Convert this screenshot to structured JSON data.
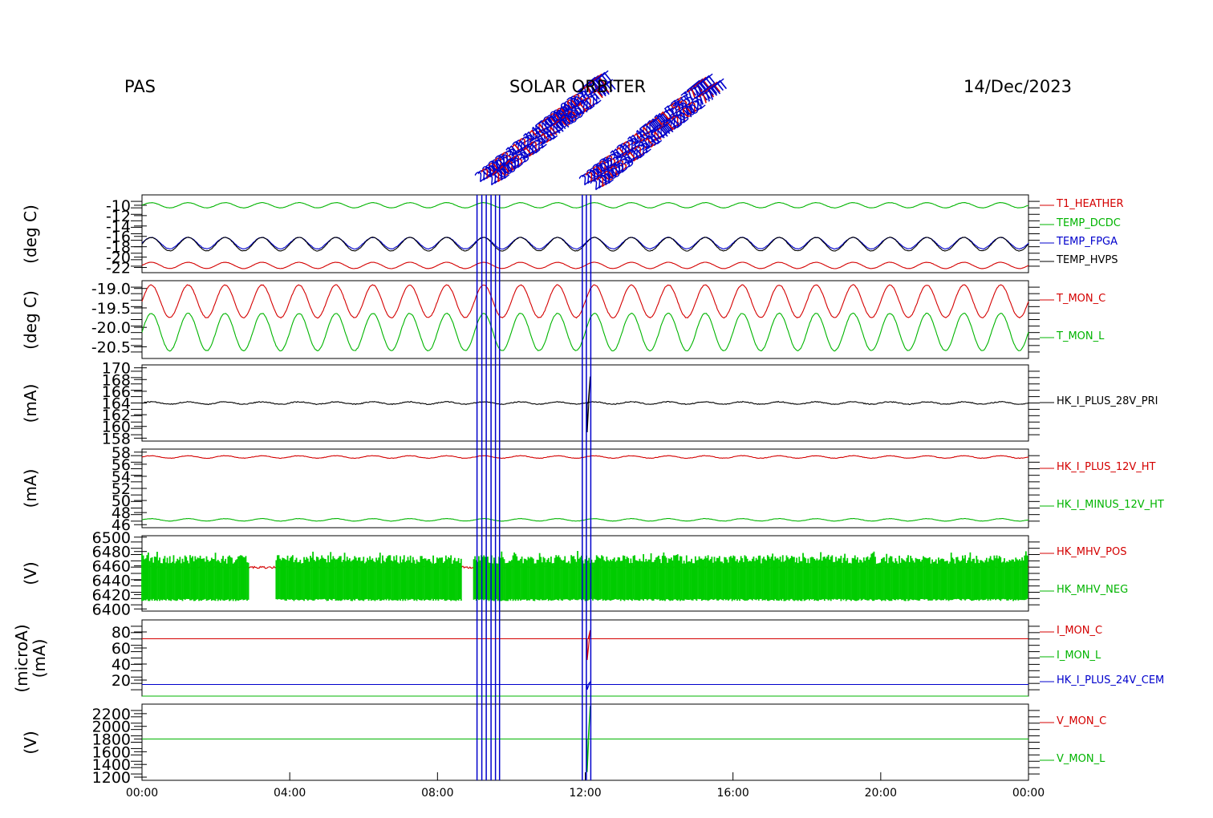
{
  "header": {
    "left": "PAS",
    "center": "SOLAR ORBITER",
    "right": "14/Dec/2023"
  },
  "colors": {
    "red": "#d40000",
    "green": "#00b400",
    "blue": "#0000cc",
    "black": "#000000",
    "fill_green": "#00cc00"
  },
  "events": {
    "times_hours": [
      9.07,
      9.2,
      9.32,
      9.45,
      9.57,
      9.68,
      11.92,
      12.03,
      12.15
    ],
    "labels": [
      "7TT",
      "TT",
      "7TT",
      "7TT"
    ],
    "label_lines": [
      "2023-12-14T09:03 7TT",
      "2023-12-14T09:12 TT",
      "2023-12-14T11:55 7TT",
      "2023-12-14T12:02 7TT"
    ]
  },
  "chart_data": [
    {
      "type": "line",
      "id": "temps",
      "ylabel": "(deg C)",
      "ylim": [
        -23,
        -8
      ],
      "yticks": [
        -10,
        -12,
        -14,
        -16,
        -18,
        -20,
        -22
      ],
      "ytick_labels": [
        "-10",
        "-12",
        "-14",
        "-16",
        "-18",
        "-20",
        "-22"
      ],
      "x_range_hours": [
        0,
        24
      ],
      "series": [
        {
          "name": "T1_HEATHER",
          "color": "red",
          "mean": -21.6,
          "amp": 0.6,
          "period_h": 1.0,
          "noise": 0.05
        },
        {
          "name": "TEMP_DCDC",
          "color": "green",
          "mean": -10.0,
          "amp": 0.5,
          "period_h": 1.0,
          "noise": 0.05
        },
        {
          "name": "TEMP_FPGA",
          "color": "blue",
          "mean": -17.3,
          "amp": 1.1,
          "period_h": 1.0,
          "noise": 0.1
        },
        {
          "name": "TEMP_HVPS",
          "color": "black",
          "mean": -17.5,
          "amp": 1.3,
          "period_h": 1.0,
          "noise": 0.1
        }
      ]
    },
    {
      "type": "line",
      "id": "tmon",
      "ylabel": "(deg C)",
      "ylim": [
        -20.8,
        -18.8
      ],
      "yticks": [
        -19.0,
        -19.5,
        -20.0,
        -20.5
      ],
      "ytick_labels": [
        "-19.0",
        "-19.5",
        "-20.0",
        "-20.5"
      ],
      "x_range_hours": [
        0,
        24
      ],
      "series": [
        {
          "name": "T_MON_C",
          "color": "red",
          "mean": -19.33,
          "amp": 0.42,
          "period_h": 1.0,
          "noise": 0.02
        },
        {
          "name": "T_MON_L",
          "color": "green",
          "mean": -20.12,
          "amp": 0.48,
          "period_h": 1.0,
          "noise": 0.02
        }
      ]
    },
    {
      "type": "line",
      "id": "i28",
      "ylabel": "(mA)",
      "ylim": [
        157.5,
        170.5
      ],
      "yticks": [
        158,
        160,
        162,
        164,
        166,
        168,
        170
      ],
      "ytick_labels": [
        "158",
        "160",
        "162",
        "164",
        "166",
        "168",
        "170"
      ],
      "x_range_hours": [
        0,
        24
      ],
      "series": [
        {
          "name": "HK_I_PLUS_28V_PRI",
          "color": "black",
          "mean": 164.0,
          "amp": 0.2,
          "period_h": 1.0,
          "noise": 0.15,
          "spike": {
            "at_h": 12.05,
            "low": 159.0,
            "high": 168.5
          }
        }
      ]
    },
    {
      "type": "line",
      "id": "i12",
      "ylabel": "(mA)",
      "ylim": [
        45.5,
        58.5
      ],
      "yticks": [
        46,
        48,
        50,
        52,
        54,
        56,
        58
      ],
      "ytick_labels": [
        "46",
        "48",
        "50",
        "52",
        "54",
        "56",
        "58"
      ],
      "x_range_hours": [
        0,
        24
      ],
      "series": [
        {
          "name": "HK_I_PLUS_12V_HT",
          "color": "red",
          "mean": 57.2,
          "amp": 0.2,
          "period_h": 1.0,
          "noise": 0.08
        },
        {
          "name": "HK_I_MINUS_12V_HT",
          "color": "green",
          "mean": 46.8,
          "amp": 0.2,
          "period_h": 1.0,
          "noise": 0.05
        }
      ]
    },
    {
      "type": "line",
      "id": "mhv",
      "ylabel": "(V)",
      "ylim": [
        6397,
        6502
      ],
      "yticks": [
        6400,
        6420,
        6440,
        6460,
        6480,
        6500
      ],
      "ytick_labels": [
        "6400",
        "6420",
        "6440",
        "6460",
        "6480",
        "6500"
      ],
      "x_range_hours": [
        0,
        24
      ],
      "series": [
        {
          "name": "HK_MHV_POS",
          "color": "red",
          "level": 6458,
          "noise": 3
        },
        {
          "name": "HK_MHV_NEG",
          "color": "green",
          "low": 6414,
          "high": 6475,
          "gaps_h": [
            [
              2.9,
              3.6
            ],
            [
              8.65,
              8.95
            ]
          ]
        }
      ]
    },
    {
      "type": "line",
      "id": "imon",
      "ylabel": "(microA)\n(mA)",
      "ylim": [
        0,
        95
      ],
      "yticks": [
        20,
        40,
        60,
        80
      ],
      "ytick_labels": [
        "20",
        "40",
        "60",
        "80"
      ],
      "x_range_hours": [
        0,
        24
      ],
      "series": [
        {
          "name": "I_MON_C",
          "color": "red",
          "level": 71.5,
          "spike": {
            "at_h": 12.05,
            "low": 45,
            "high": 82
          }
        },
        {
          "name": "I_MON_L",
          "color": "green",
          "level": 0
        },
        {
          "name": "HK_I_PLUS_24V_CEM",
          "color": "blue",
          "level": 14.5,
          "spike": {
            "at_h": 12.05,
            "low": 8,
            "high": 18
          }
        }
      ]
    },
    {
      "type": "line",
      "id": "vmon",
      "ylabel": "(V)",
      "ylim": [
        1150,
        2350
      ],
      "yticks": [
        1200,
        1400,
        1600,
        1800,
        2000,
        2200
      ],
      "ytick_labels": [
        "1200",
        "1400",
        "1600",
        "1800",
        "2000",
        "2200"
      ],
      "x_range_hours": [
        0,
        24
      ],
      "series": [
        {
          "name": "V_MON_C",
          "color": "red",
          "level": 1800
        },
        {
          "name": "V_MON_L",
          "color": "green",
          "level": 1800,
          "spike": {
            "at_h": 12.05,
            "low": 1280,
            "high": 2320
          }
        }
      ]
    }
  ],
  "x_axis": {
    "ticks_hours": [
      0,
      4,
      8,
      12,
      16,
      20,
      24
    ],
    "tick_labels": [
      "00:00",
      "04:00",
      "08:00",
      "12:00",
      "16:00",
      "20:00",
      "00:00"
    ]
  }
}
